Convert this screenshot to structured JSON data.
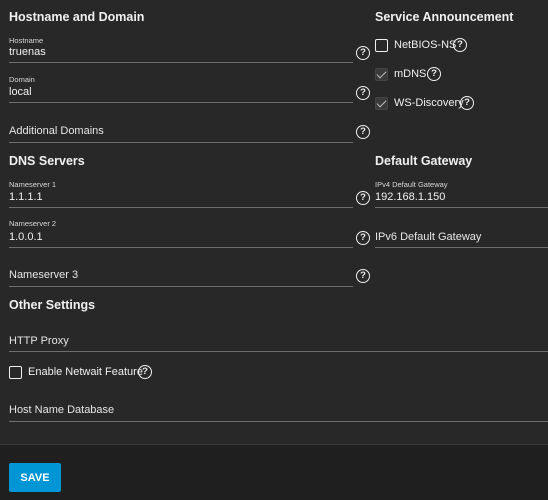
{
  "hostname_domain": {
    "title": "Hostname and Domain",
    "hostname": {
      "label": "Hostname",
      "value": "truenas"
    },
    "domain": {
      "label": "Domain",
      "value": "local"
    },
    "additional_domains": {
      "placeholder": "Additional Domains"
    }
  },
  "service_announcement": {
    "title": "Service Announcement",
    "items": [
      {
        "label": "NetBIOS-NS",
        "checked": false
      },
      {
        "label": "mDNS",
        "checked": true
      },
      {
        "label": "WS-Discovery",
        "checked": true
      }
    ]
  },
  "dns_servers": {
    "title": "DNS Servers",
    "nameserver1": {
      "label": "Nameserver 1",
      "value": "1.1.1.1"
    },
    "nameserver2": {
      "label": "Nameserver 2",
      "value": "1.0.0.1"
    },
    "nameserver3": {
      "placeholder": "Nameserver 3"
    }
  },
  "default_gateway": {
    "title": "Default Gateway",
    "ipv4": {
      "label": "IPv4 Default Gateway",
      "value": "192.168.1.150"
    },
    "ipv6": {
      "placeholder": "IPv6 Default Gateway"
    }
  },
  "other_settings": {
    "title": "Other Settings",
    "http_proxy": {
      "placeholder": "HTTP Proxy"
    },
    "netwait": {
      "label": "Enable Netwait Feature",
      "checked": false
    },
    "host_name_database": {
      "placeholder": "Host Name Database"
    }
  },
  "help_glyph": "?",
  "save_label": "SAVE",
  "colors": {
    "accent": "#0095d5",
    "background": "#282828",
    "footer": "#1f1f1f"
  }
}
